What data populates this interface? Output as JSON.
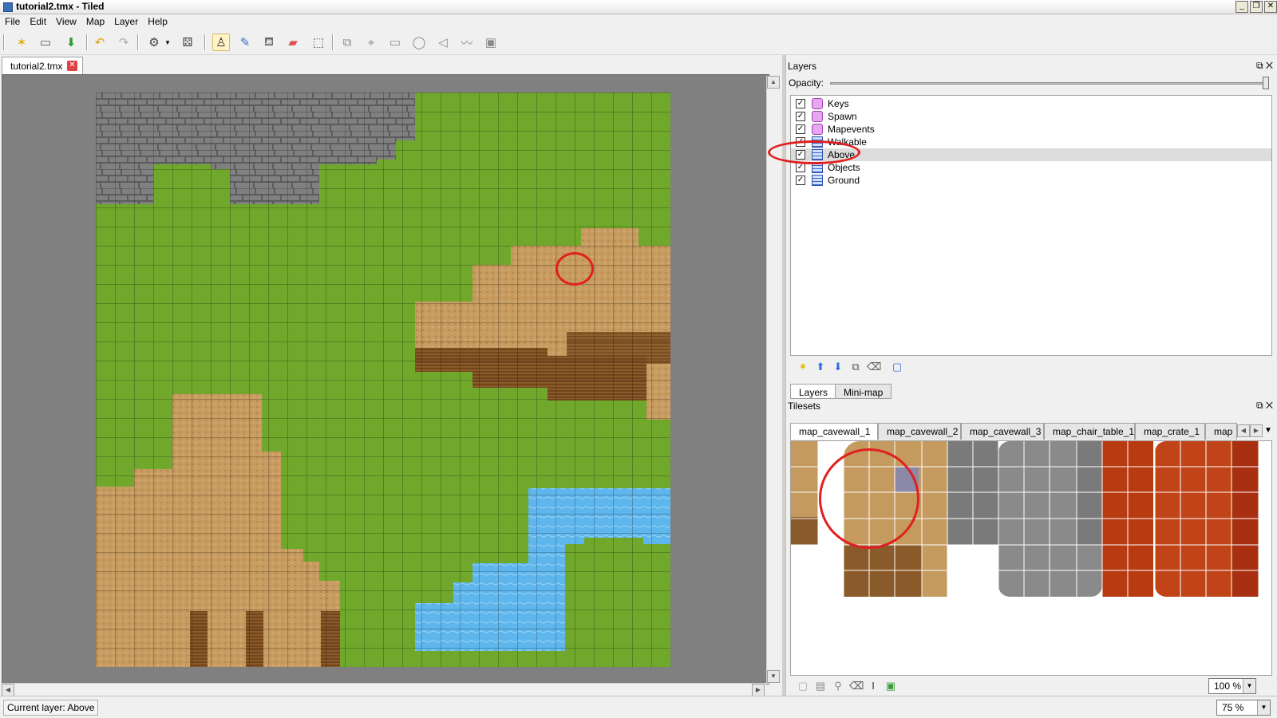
{
  "window": {
    "title": "tutorial2.tmx - Tiled"
  },
  "menu": [
    "File",
    "Edit",
    "View",
    "Map",
    "Layer",
    "Help"
  ],
  "toolbar": {
    "icons": [
      "new-map-icon",
      "open-icon",
      "save-icon",
      "undo-icon",
      "redo-icon",
      "random-mode-icon",
      "dice-icon",
      "stamp-brush-icon",
      "terrain-brush-icon",
      "bucket-fill-icon",
      "eraser-icon",
      "rect-select-icon",
      "select-objects-icon",
      "edit-polygons-icon",
      "insert-rectangle-icon",
      "insert-ellipse-icon",
      "insert-polygon-icon",
      "insert-polyline-icon",
      "insert-tile-icon"
    ]
  },
  "document": {
    "tab_label": "tutorial2.tmx"
  },
  "layers_panel": {
    "title": "Layers",
    "opacity_label": "Opacity:",
    "opacity": 1.0,
    "layers": [
      {
        "name": "Keys",
        "type": "object",
        "visible": true,
        "selected": false
      },
      {
        "name": "Spawn",
        "type": "object",
        "visible": true,
        "selected": false
      },
      {
        "name": "Mapevents",
        "type": "object",
        "visible": true,
        "selected": false
      },
      {
        "name": "Walkable",
        "type": "tile",
        "visible": true,
        "selected": false
      },
      {
        "name": "Above",
        "type": "tile",
        "visible": true,
        "selected": true
      },
      {
        "name": "Objects",
        "type": "tile",
        "visible": true,
        "selected": false
      },
      {
        "name": "Ground",
        "type": "tile",
        "visible": true,
        "selected": false
      }
    ],
    "tabs": [
      "Layers",
      "Mini-map"
    ]
  },
  "tilesets_panel": {
    "title": "Tilesets",
    "tabs": [
      "map_cavewall_1",
      "map_cavewall_2",
      "map_cavewall_3",
      "map_chair_table_1",
      "map_crate_1",
      "map"
    ],
    "active_tab": "map_cavewall_1",
    "zoom": "100 %"
  },
  "status": {
    "current_layer": "Current layer: Above",
    "zoom": "75 %"
  },
  "colors": {
    "grass": "#6fa82b",
    "dirt": "#c49a5e",
    "rock": "#7a7a7a",
    "water": "#5eb6ec",
    "annotation": "#e02020"
  }
}
